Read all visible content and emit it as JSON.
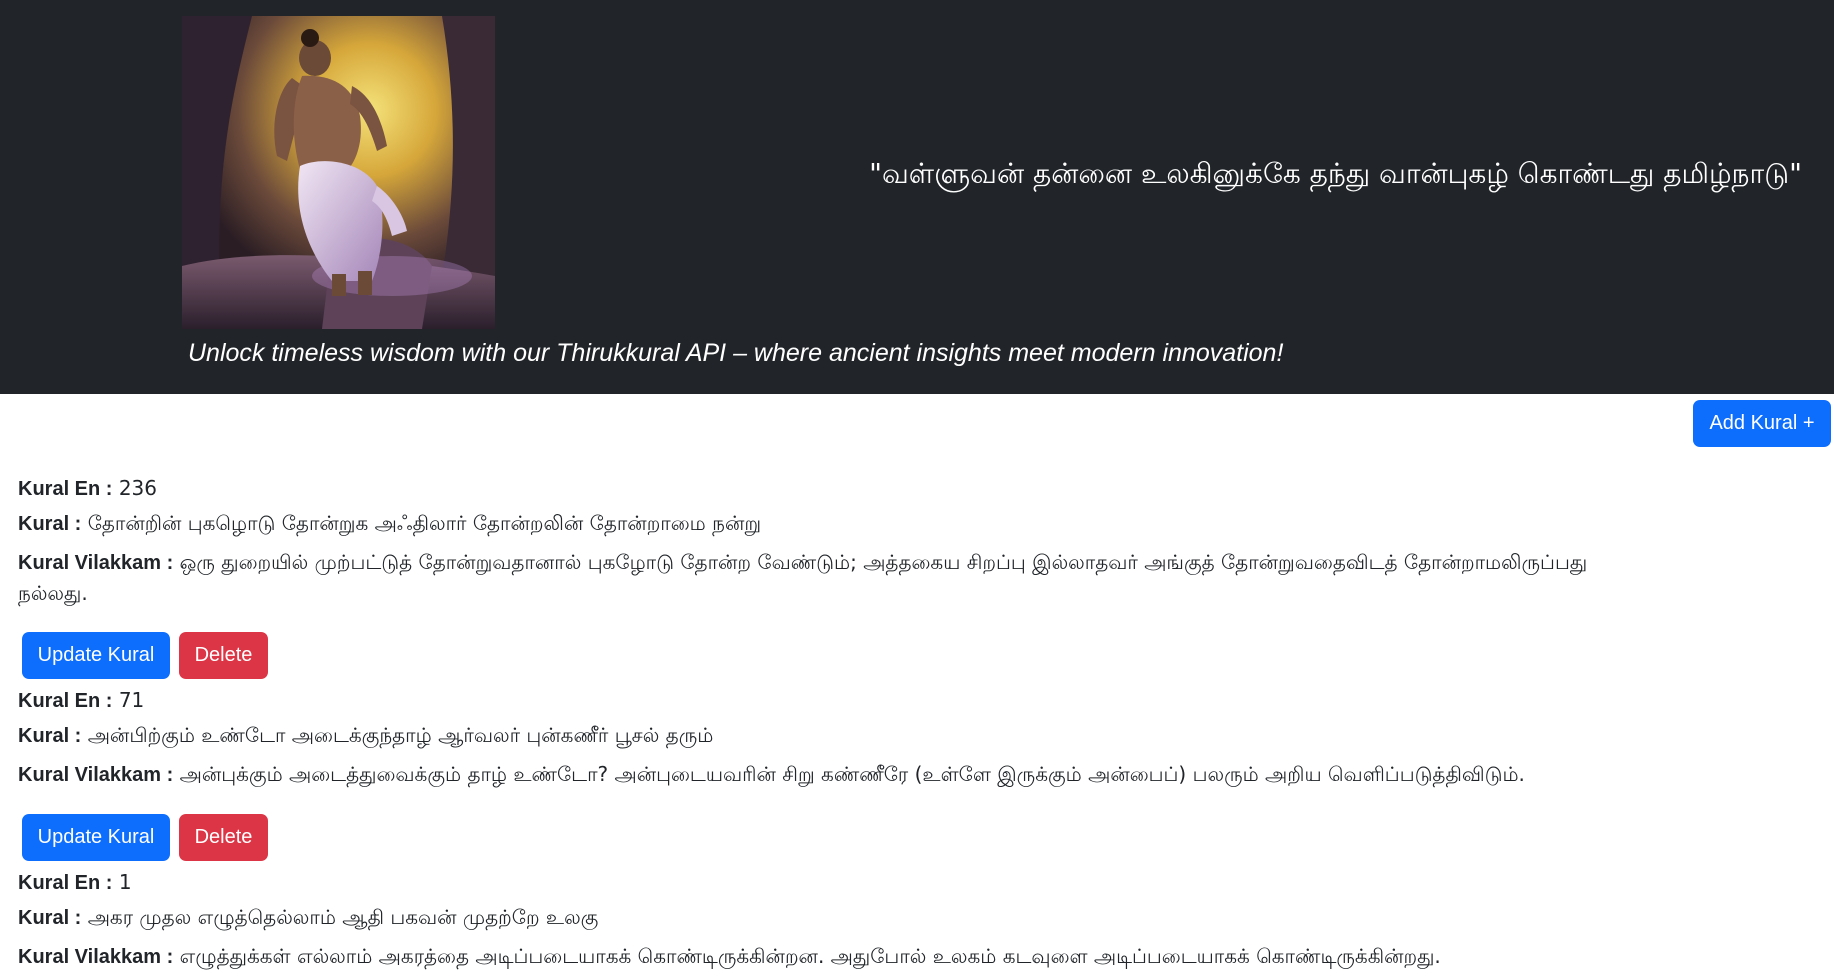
{
  "header": {
    "quote": "\"வள்ளுவன் தன்னை உலகினுக்கே தந்து வான்புகழ் கொண்டது தமிழ்நாடு\"",
    "tagline": "Unlock timeless wisdom with our Thirukkural API – where ancient insights meet modern innovation!"
  },
  "toolbar": {
    "add_label": "Add Kural +"
  },
  "labels": {
    "kural_en": "Kural En :",
    "kural": "Kural :",
    "vilakkam": "Kural Vilakkam :",
    "update": "Update Kural",
    "delete": "Delete"
  },
  "kurals": [
    {
      "en": "236",
      "kural": "தோன்றின் புகழொடு தோன்றுக அஃதிலார் தோன்றலின் தோன்றாமை நன்று",
      "vilakkam": "ஒரு துறையில் முற்பட்டுத் தோன்றுவதானால் புகழோடு தோன்ற வேண்டும்; அத்தகைய சிறப்பு இல்லாதவர் அங்குத் தோன்றுவதைவிடத் தோன்றாமலிருப்பது நல்லது."
    },
    {
      "en": "71",
      "kural": "அன்பிற்கும் உண்டோ அடைக்குந்தாழ் ஆர்வலர் புன்கணீர் பூசல் தரும்",
      "vilakkam": "அன்புக்கும் அடைத்துவைக்கும் தாழ் உண்டோ? அன்புடையவரின் சிறு கண்ணீரே (உள்ளே இருக்கும் அன்பைப்) பலரும் அறிய வெளிப்படுத்திவிடும்."
    },
    {
      "en": "1",
      "kural": "அகர முதல எழுத்தெல்லாம் ஆதி பகவன் முதற்றே உலகு",
      "vilakkam": "எழுத்துக்கள் எல்லாம் அகரத்தை அடிப்படையாகக் கொண்டிருக்கின்றன. அதுபோல் உலகம் கடவுளை அடிப்படையாகக் கொண்டிருக்கின்றது."
    }
  ],
  "colors": {
    "header_bg": "#212529",
    "primary": "#0d6efd",
    "danger": "#dc3545"
  }
}
